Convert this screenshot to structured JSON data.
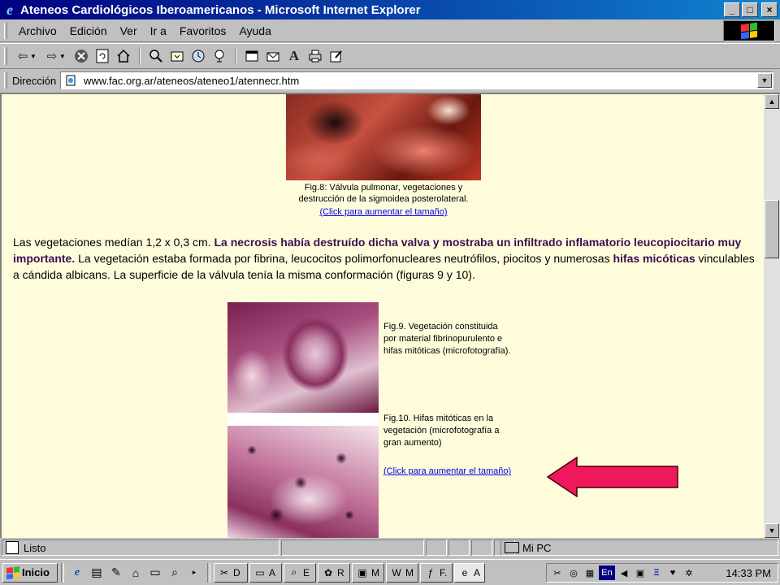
{
  "window": {
    "title": "Ateneos Cardiológicos Iberoamericanos - Microsoft Internet Explorer",
    "minimize": "_",
    "maximize": "□",
    "close": "×"
  },
  "menu": {
    "items": [
      "Archivo",
      "Edición",
      "Ver",
      "Ir a",
      "Favoritos",
      "Ayuda"
    ]
  },
  "toolbar": {
    "icons": [
      "back-icon",
      "forward-icon",
      "stop-icon",
      "refresh-icon",
      "home-icon",
      "search-icon",
      "favorites-icon",
      "history-icon",
      "channels-icon",
      "fullscreen-icon",
      "mail-icon",
      "fonts-icon",
      "print-icon",
      "edit-icon"
    ]
  },
  "address": {
    "label": "Dirección",
    "url": "www.fac.org.ar/ateneos/ateneo1/atennecr.htm"
  },
  "page": {
    "fig8_caption_line1": "Fig.8: Válvula pulmonar, vegetaciones y",
    "fig8_caption_line2": "destrucción de la sigmoidea posterolateral.",
    "fig8_link": "(Click para aumentar el tamaño)",
    "para_t1": "Las vegetaciones medían 1,2 x 0,3 cm. ",
    "para_b1": "La necrosis había destruído dicha valva y mostraba un infiltrado inflamatorio leucopiocitario muy importante.",
    "para_t2": " La vegetación estaba formada por fibrina, leucocitos polimorfonucleares neutrófilos, piocitos y numerosas ",
    "para_b2": "hifas micóticas",
    "para_t3": " vinculables a cándida albicans. La superficie de la válvula tenía la misma conformación (figuras 9 y 10).",
    "fig9_caption_line1": "Fig.9. Vegetación constituida",
    "fig9_caption_line2": "por material fibrinopurulento e",
    "fig9_caption_line3": "hifas mitóticas (microfotografía).",
    "fig10_caption_line1": "Fig.10. Hifas mitóticas en la",
    "fig10_caption_line2": "vegetación (microfotografía a",
    "fig10_caption_line3": "gran aumento)",
    "fig910_link": "(Click para aumentar el tamaño)",
    "arrow_color": "#f0185c"
  },
  "status": {
    "text": "Listo",
    "zone": "Mi PC"
  },
  "taskbar": {
    "start_label": "Inicio",
    "tasks": [
      {
        "label": "D",
        "icon": "acrobat-icon"
      },
      {
        "label": "A",
        "icon": "folder-icon"
      },
      {
        "label": "E",
        "icon": "explorer-icon"
      },
      {
        "label": "R",
        "icon": "paint-icon"
      },
      {
        "label": "M",
        "icon": "monitor-icon"
      },
      {
        "label": "M",
        "icon": "word-icon"
      },
      {
        "label": "F.",
        "icon": "flash-icon"
      },
      {
        "label": "A",
        "icon": "ie-icon"
      }
    ],
    "language": "En",
    "clock": "14:33 PM"
  }
}
